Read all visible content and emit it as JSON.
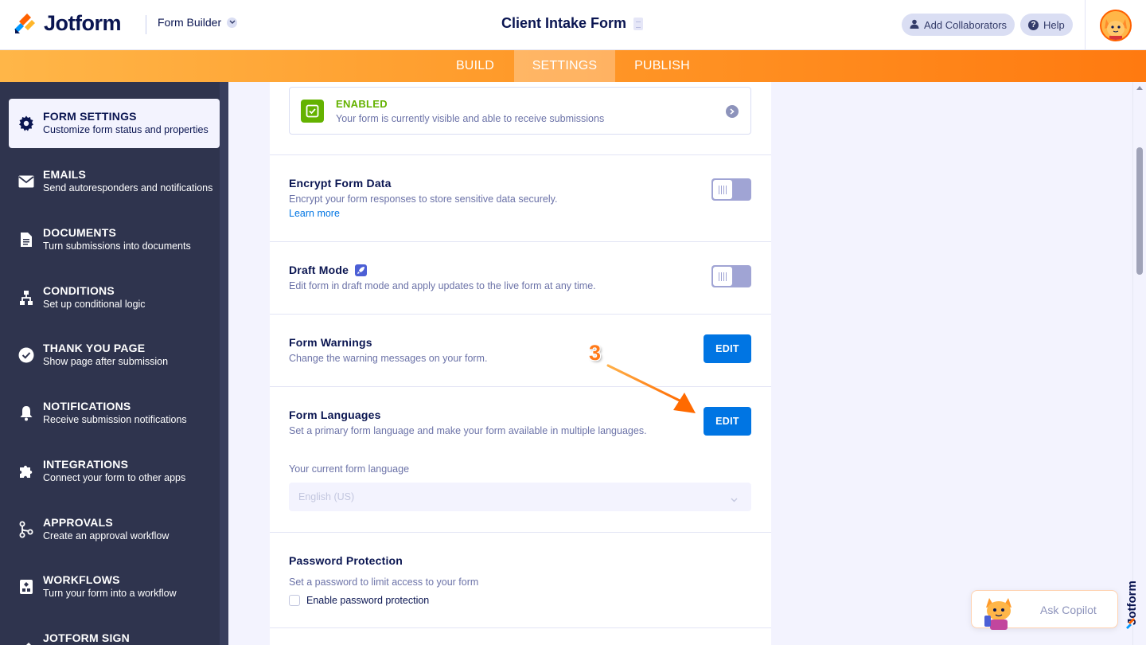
{
  "header": {
    "logo_text": "Jotform",
    "builder_label": "Form Builder",
    "form_title": "Client Intake Form",
    "add_collaborators": "Add Collaborators",
    "help": "Help"
  },
  "nav": {
    "tabs": [
      "BUILD",
      "SETTINGS",
      "PUBLISH"
    ],
    "active_tab": "SETTINGS"
  },
  "sidebar": {
    "items": [
      {
        "title": "FORM SETTINGS",
        "subtitle": "Customize form status and properties",
        "icon": "gear-icon",
        "active": true
      },
      {
        "title": "EMAILS",
        "subtitle": "Send autoresponders and notifications",
        "icon": "envelope-icon"
      },
      {
        "title": "DOCUMENTS",
        "subtitle": "Turn submissions into documents",
        "icon": "document-icon"
      },
      {
        "title": "CONDITIONS",
        "subtitle": "Set up conditional logic",
        "icon": "hierarchy-icon"
      },
      {
        "title": "THANK YOU PAGE",
        "subtitle": "Show page after submission",
        "icon": "check-circle-icon"
      },
      {
        "title": "NOTIFICATIONS",
        "subtitle": "Receive submission notifications",
        "icon": "bell-icon"
      },
      {
        "title": "INTEGRATIONS",
        "subtitle": "Connect your form to other apps",
        "icon": "puzzle-icon"
      },
      {
        "title": "APPROVALS",
        "subtitle": "Create an approval workflow",
        "icon": "approval-flow-icon"
      },
      {
        "title": "WORKFLOWS",
        "subtitle": "Turn your form into a workflow",
        "icon": "workflow-icon"
      },
      {
        "title": "JOTFORM SIGN",
        "subtitle": "",
        "icon": "sign-icon"
      }
    ]
  },
  "status": {
    "title": "ENABLED",
    "description": "Your form is currently visible and able to receive submissions"
  },
  "options": {
    "encrypt": {
      "title": "Encrypt Form Data",
      "description": "Encrypt your form responses to store sensitive data securely.",
      "link": "Learn more",
      "enabled": false
    },
    "draft": {
      "title": "Draft Mode",
      "description": "Edit form in draft mode and apply updates to the live form at any time.",
      "enabled": false
    },
    "warnings": {
      "title": "Form Warnings",
      "description": "Change the warning messages on your form.",
      "button": "EDIT"
    },
    "languages": {
      "title": "Form Languages",
      "description": "Set a primary form language and make your form available in multiple languages.",
      "button": "EDIT",
      "current_label": "Your current form language",
      "current_value": "English (US)"
    },
    "password": {
      "title": "Password Protection",
      "description": "Set a password to limit access to your form",
      "checkbox_label": "Enable password protection",
      "checked": false
    }
  },
  "annotation": {
    "step": "3"
  },
  "copilot": {
    "label": "Ask Copilot"
  },
  "colors": {
    "accent_orange": "#ff7a10",
    "primary_blue": "#0075e3",
    "sidebar_bg": "#2f344e",
    "enabled_green": "#64b200",
    "navy_text": "#0a1551"
  }
}
